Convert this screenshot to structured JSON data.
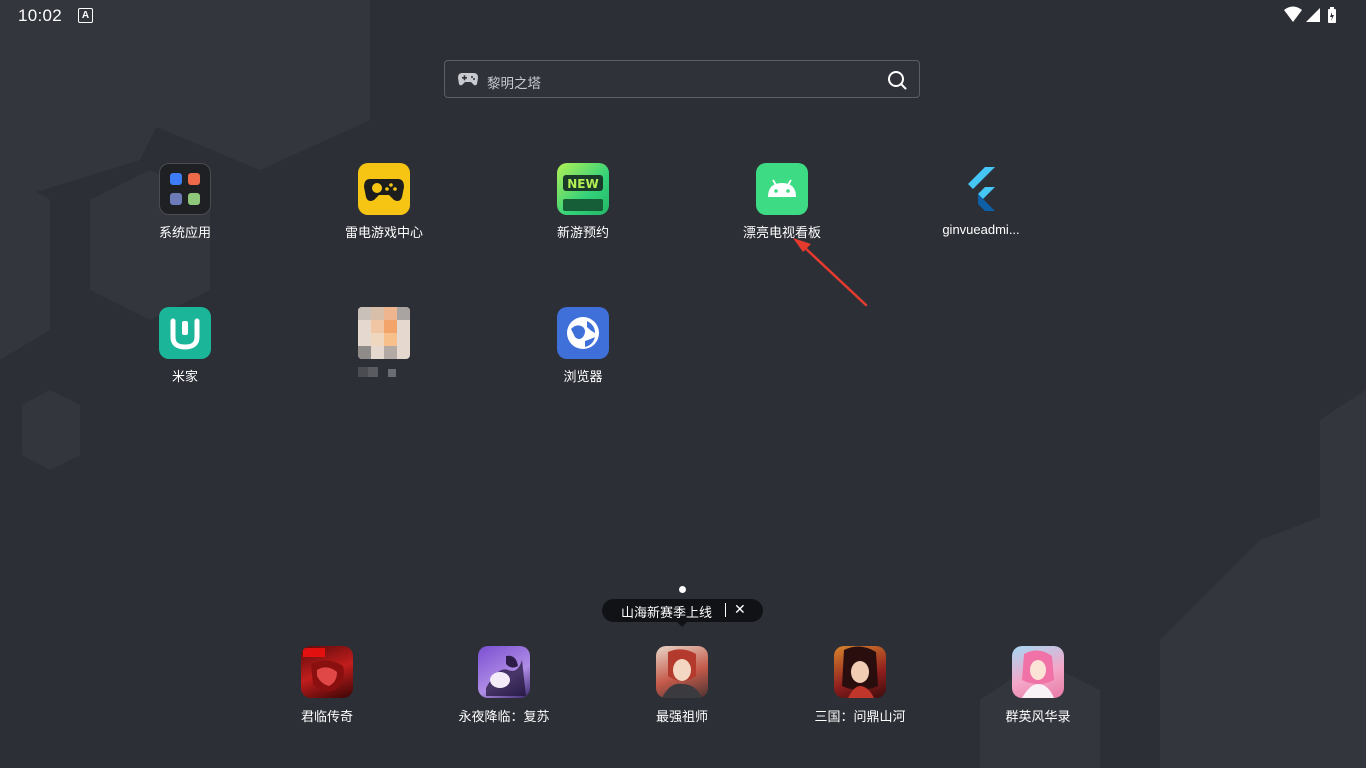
{
  "status_bar": {
    "time": "10:02",
    "icons": [
      "app-notification-icon",
      "wifi-icon",
      "signal-icon",
      "battery-charging-icon"
    ]
  },
  "search": {
    "placeholder": "黎明之塔",
    "left_icon": "gamepad-icon",
    "right_icon": "search-icon"
  },
  "apps": [
    {
      "label": "系统应用",
      "icon": "system-apps-folder-icon"
    },
    {
      "label": "雷电游戏中心",
      "icon": "ldplayer-game-center-icon"
    },
    {
      "label": "新游预约",
      "icon": "new-games-icon"
    },
    {
      "label": "漂亮电视看板",
      "icon": "android-icon"
    },
    {
      "label": "ginvueadmi...",
      "icon": "flutter-icon"
    },
    {
      "label": "米家",
      "icon": "mijia-icon"
    },
    {
      "label": "",
      "icon": "pixelated-app-icon"
    },
    {
      "label": "浏览器",
      "icon": "browser-icon"
    }
  ],
  "page_indicator": {
    "current": 1,
    "total": 1
  },
  "tooltip": {
    "text": "山海新赛季上线",
    "close": "✕"
  },
  "dock": [
    {
      "label": "君临传奇",
      "icon": "junlin-chuanqi-icon"
    },
    {
      "label": "永夜降临：复苏",
      "icon": "yongye-jianglin-icon"
    },
    {
      "label": "最强祖师",
      "icon": "zuiqiang-zushi-icon"
    },
    {
      "label": "三国：问鼎山河",
      "icon": "sanguo-wending-icon"
    },
    {
      "label": "群英风华录",
      "icon": "qunying-fenghua-icon"
    }
  ],
  "colors": {
    "background": "#2d2f36",
    "annotation_arrow": "#e53b2f",
    "mijia": "#1bb69a",
    "ldplayer": "#f6c514",
    "android": "#3ddc84",
    "browser": "#3f6fd9"
  }
}
